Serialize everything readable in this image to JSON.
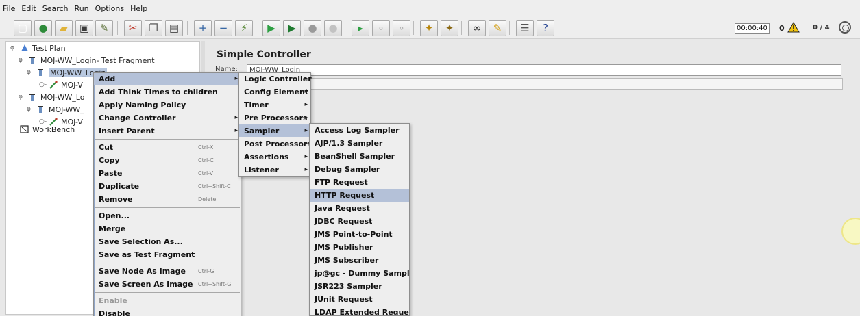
{
  "menubar": {
    "items": [
      "File",
      "Edit",
      "Search",
      "Run",
      "Options",
      "Help"
    ]
  },
  "toolbar": {
    "buttons": [
      {
        "name": "new-icon",
        "glyph": "▢",
        "color": "#ffffff"
      },
      {
        "name": "templates-icon",
        "glyph": "●",
        "color": "#2e8b3a"
      },
      {
        "name": "open-icon",
        "glyph": "▰",
        "color": "#e0b33a"
      },
      {
        "name": "save-icon",
        "glyph": "▣",
        "color": "#3a3a3a"
      },
      {
        "name": "save-as-icon",
        "glyph": "✎",
        "color": "#556b2f"
      },
      {
        "name": "cut-icon",
        "glyph": "✂",
        "color": "#c0392b"
      },
      {
        "name": "copy-icon",
        "glyph": "❐",
        "color": "#666666"
      },
      {
        "name": "paste-icon",
        "glyph": "▤",
        "color": "#444444"
      },
      {
        "name": "expand-icon",
        "glyph": "+",
        "color": "#3465a4"
      },
      {
        "name": "collapse-icon",
        "glyph": "−",
        "color": "#3465a4"
      },
      {
        "name": "toggle-icon",
        "glyph": "⚡",
        "color": "#5a8a3a"
      },
      {
        "name": "start-icon",
        "glyph": "▶",
        "color": "#2ea043"
      },
      {
        "name": "start-no-pause-icon",
        "glyph": "▶",
        "color": "#1f7a30"
      },
      {
        "name": "stop-icon",
        "glyph": "●",
        "color": "#9a9a9a"
      },
      {
        "name": "shutdown-icon",
        "glyph": "●",
        "color": "#c2c2c2"
      },
      {
        "name": "remote-start-icon",
        "glyph": "▸",
        "color": "#2ea043"
      },
      {
        "name": "remote-stop-icon",
        "glyph": "∘",
        "color": "#999999"
      },
      {
        "name": "remote-shutdown-icon",
        "glyph": "∘",
        "color": "#aaaaaa"
      },
      {
        "name": "clear-icon",
        "glyph": "✦",
        "color": "#b8860b"
      },
      {
        "name": "clear-all-icon",
        "glyph": "✦",
        "color": "#8b6914"
      },
      {
        "name": "search-icon",
        "glyph": "∞",
        "color": "#222222"
      },
      {
        "name": "reset-search-icon",
        "glyph": "✎",
        "color": "#d4a017"
      },
      {
        "name": "function-helper-icon",
        "glyph": "☰",
        "color": "#555555"
      },
      {
        "name": "help-icon",
        "glyph": "?",
        "color": "#1f3f8f"
      }
    ]
  },
  "status": {
    "timer": "00:00:40",
    "error_count": "0",
    "warn_color": "#f1c40f",
    "threads": "0 / 4"
  },
  "tree": {
    "nodes": [
      {
        "label": "Test Plan",
        "toggle": "φ",
        "icon": "test-plan-icon"
      },
      {
        "label": "MOJ-WW_Login- Test Fragment",
        "toggle": "φ",
        "icon": "fragment-icon"
      },
      {
        "label": "MOJ-WW_Login",
        "toggle": "φ",
        "icon": "controller-icon"
      },
      {
        "label": "MOJ-V",
        "toggle": "○-",
        "icon": "sampler-icon"
      },
      {
        "label": "MOJ-WW_Lo",
        "toggle": "φ",
        "icon": "fragment-icon"
      },
      {
        "label": "MOJ-WW_",
        "toggle": "φ",
        "icon": "controller-icon"
      },
      {
        "label": "MOJ-V",
        "toggle": "○-",
        "icon": "sampler-icon"
      },
      {
        "label": "WorkBench",
        "toggle": "",
        "icon": "workbench-icon"
      }
    ]
  },
  "right_panel": {
    "title": "Simple Controller",
    "name_label": "Name:",
    "name_value": "MOJ-WW_Login"
  },
  "context_menu": {
    "items": [
      {
        "label": "Add",
        "arrow": "▸",
        "highlight": true
      },
      {
        "label": "Add Think Times to children"
      },
      {
        "label": "Apply Naming Policy"
      },
      {
        "label": "Change Controller",
        "arrow": "▸"
      },
      {
        "label": "Insert Parent",
        "arrow": "▸"
      },
      {
        "sep": true
      },
      {
        "label": "Cut",
        "acc": "Ctrl-X"
      },
      {
        "label": "Copy",
        "acc": "Ctrl-C"
      },
      {
        "label": "Paste",
        "acc": "Ctrl-V"
      },
      {
        "label": "Duplicate",
        "acc": "Ctrl+Shift-C"
      },
      {
        "label": "Remove",
        "acc": "Delete"
      },
      {
        "sep": true
      },
      {
        "label": "Open..."
      },
      {
        "label": "Merge"
      },
      {
        "label": "Save Selection As..."
      },
      {
        "label": "Save as Test Fragment"
      },
      {
        "sep": true
      },
      {
        "label": "Save Node As Image",
        "acc": "Ctrl-G"
      },
      {
        "label": "Save Screen As Image",
        "acc": "Ctrl+Shift-G"
      },
      {
        "sep": true
      },
      {
        "label": "Enable",
        "disabled": true
      },
      {
        "label": "Disable"
      }
    ]
  },
  "add_submenu": {
    "items": [
      {
        "label": "Logic Controller",
        "arrow": "▸"
      },
      {
        "label": "Config Element",
        "arrow": "▸"
      },
      {
        "label": "Timer",
        "arrow": "▸"
      },
      {
        "label": "Pre Processors",
        "arrow": "▸"
      },
      {
        "label": "Sampler",
        "arrow": "▸",
        "highlight": true
      },
      {
        "label": "Post Processors",
        "arrow": "▸"
      },
      {
        "label": "Assertions",
        "arrow": "▸"
      },
      {
        "label": "Listener",
        "arrow": "▸"
      }
    ]
  },
  "sampler_submenu": {
    "items": [
      {
        "label": "Access Log Sampler"
      },
      {
        "label": "AJP/1.3 Sampler"
      },
      {
        "label": "BeanShell Sampler"
      },
      {
        "label": "Debug Sampler"
      },
      {
        "label": "FTP Request"
      },
      {
        "label": "HTTP Request",
        "highlight": true
      },
      {
        "label": "Java Request"
      },
      {
        "label": "JDBC Request"
      },
      {
        "label": "JMS Point-to-Point"
      },
      {
        "label": "JMS Publisher"
      },
      {
        "label": "JMS Subscriber"
      },
      {
        "label": "jp@gc - Dummy Sampler"
      },
      {
        "label": "JSR223 Sampler"
      },
      {
        "label": "JUnit Request"
      },
      {
        "label": "LDAP Extended Request"
      }
    ]
  }
}
